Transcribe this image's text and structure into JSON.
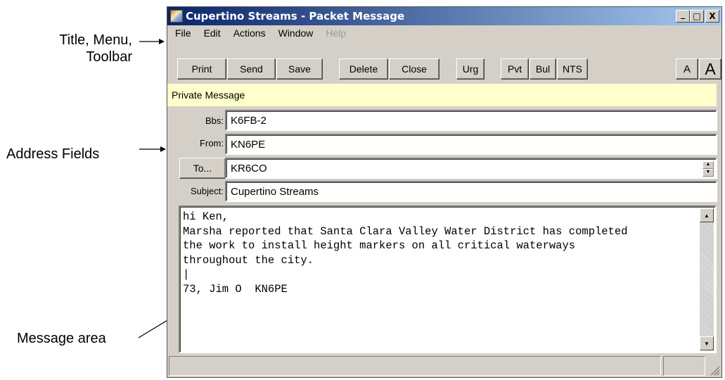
{
  "annotations": {
    "title_menu_toolbar_line1": "Title, Menu,",
    "title_menu_toolbar_line2": "Toolbar",
    "address_fields": "Address Fields",
    "message_area": "Message area"
  },
  "window": {
    "title": "Cupertino Streams - Packet Message",
    "controls": {
      "minimize": "_",
      "maximize": "□",
      "close": "X"
    }
  },
  "menu": {
    "items": [
      {
        "label": "File",
        "enabled": true
      },
      {
        "label": "Edit",
        "enabled": true
      },
      {
        "label": "Actions",
        "enabled": true
      },
      {
        "label": "Window",
        "enabled": true
      },
      {
        "label": "Help",
        "enabled": false
      }
    ]
  },
  "toolbar": {
    "buttons": [
      "Print",
      "Send",
      "Save",
      "Delete",
      "Close",
      "Urg",
      "Pvt",
      "Bul",
      "NTS",
      "A",
      "A"
    ]
  },
  "status_strip": {
    "text": "Private Message"
  },
  "address": {
    "bbs_label": "Bbs:",
    "bbs_value": "K6FB-2",
    "from_label": "From:",
    "from_value": "KN6PE",
    "to_button": "To...",
    "to_value": "KR6CO",
    "subject_label": "Subject:",
    "subject_value": "Cupertino Streams"
  },
  "message": {
    "body": "hi Ken,\nMarsha reported that Santa Clara Valley Water District has completed\nthe work to install height markers on all critical waterways\nthroughout the city.\n|\n73, Jim O  KN6PE"
  },
  "colors": {
    "titlebar_start": "#0a246a",
    "titlebar_end": "#a6caf0",
    "status_strip_bg": "#ffffcc",
    "window_face": "#d4d0c8"
  }
}
